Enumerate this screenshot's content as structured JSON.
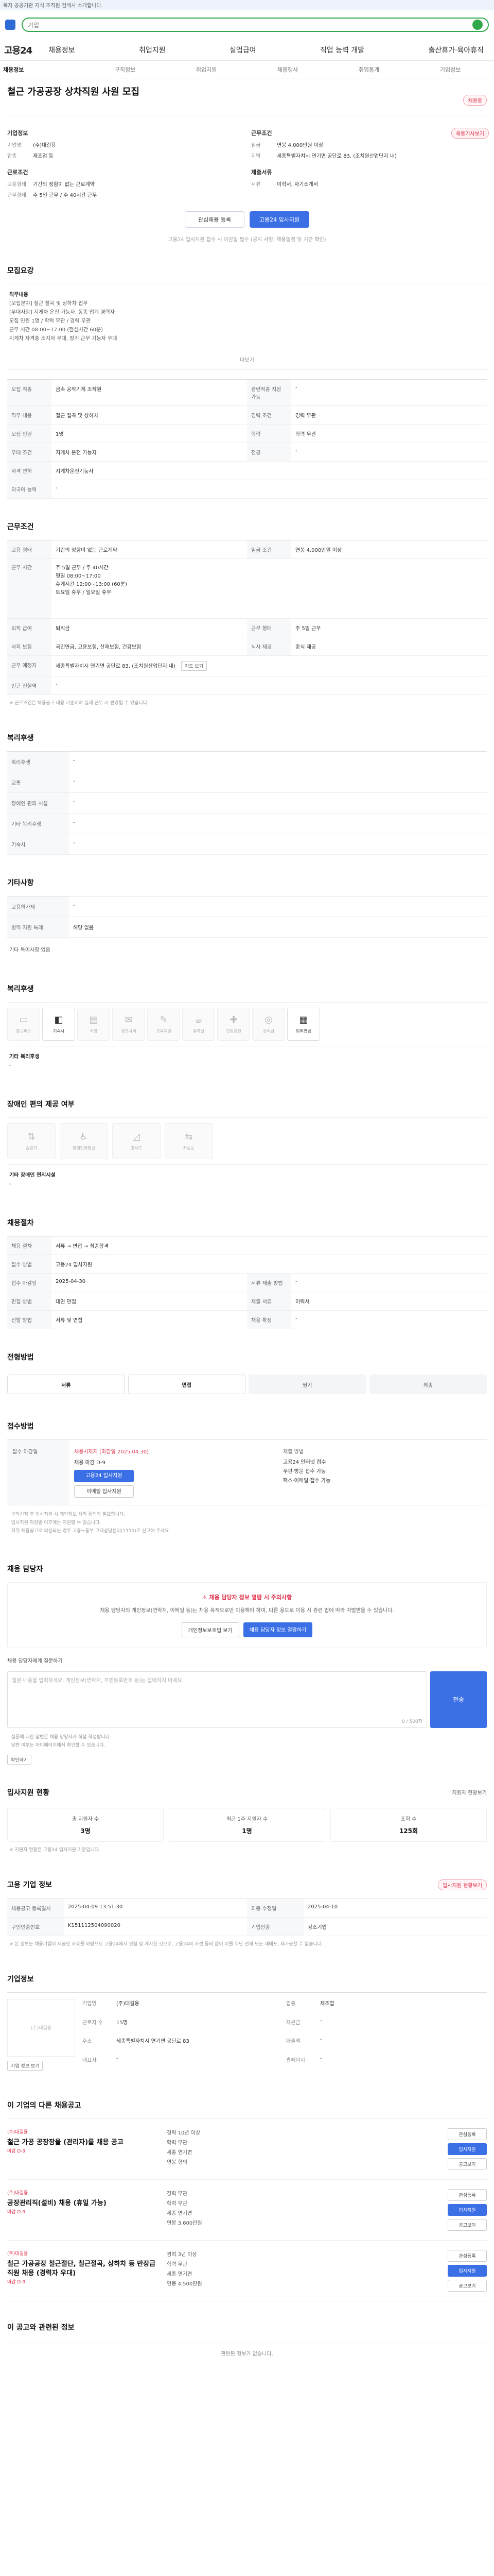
{
  "topbar": {
    "notice": "복지 공공기관 지식 조직원 검색사 소개합니다."
  },
  "header": {
    "search_placeholder": "기업"
  },
  "gnb": {
    "logo": "고용24",
    "menu": [
      "채용정보",
      "취업지원",
      "실업급여",
      "직업 능력 개발",
      "출산휴가·육아휴직"
    ]
  },
  "tabs": [
    "채용정보",
    "구직정보",
    "취업지원",
    "채용행사",
    "취업통계",
    "기업정보"
  ],
  "badge": "채용기사보기",
  "job": {
    "title": "철근 가공공장 상차직원 사원 모집",
    "tag": "채용중",
    "left_heading_company": "기업정보",
    "company": [
      {
        "k": "기업명",
        "v": "(주)대길용"
      },
      {
        "k": "업종",
        "v": "제조업 등"
      }
    ],
    "left_heading_conditions": "근로조건",
    "conditions": [
      {
        "k": "고용형태",
        "v": "기간의 정함이 없는 근로계약"
      },
      {
        "k": "근무형태",
        "v": "주 5일 근무 / 주 40시간 근무"
      }
    ],
    "right_heading": "근무조건",
    "right": [
      {
        "k": "임금",
        "v": "연봉 4,000만원 이상"
      },
      {
        "k": "지역",
        "v": "세종특별자치시 연기면 공단로 83, (조치원산업단지 내)"
      }
    ],
    "right_heading2": "제출서류",
    "right2": [
      {
        "k": "서류",
        "v": "이력서, 자기소개서"
      }
    ],
    "btn_save": "관심채용 등록",
    "btn_apply": "고용24 입사지원",
    "apply_note": "고용24 입사지원 접수 시 마감일 필수 (공지 사항, 채용일정 및 기간 확인)"
  },
  "recruit": {
    "heading": "모집요강",
    "title_label": "직무내용",
    "body": [
      "[모집분야] 철근 절곡 및 상하차 업무",
      "[우대사항] 지게차 운전 가능자, 동종 업계 경력자",
      "모집 인원 1명 / 학력 무관 / 경력 무관",
      "근무 시간 08:00~17:00 (점심시간 60분)",
      "지게차 자격증 소지자 우대, 장기 근무 가능자 우대"
    ],
    "more": "더보기",
    "rows": [
      {
        "k": "모집 직종",
        "v": "금속 공작기계 조작원",
        "k2": "관련직종 지원 가능",
        "v2": "-"
      },
      {
        "k": "직무 내용",
        "v": "철근 절곡 및 상하차",
        "k2": "경력 조건",
        "v2": "경력 무관"
      },
      {
        "k": "모집 인원",
        "v": "1명",
        "k2": "학력",
        "v2": "학력 무관"
      },
      {
        "k": "우대 조건",
        "v": "지게차 운전 가능자",
        "k2": "전공",
        "v2": "-"
      },
      {
        "k": "자격 면허",
        "v": "지게차운전기능사",
        "k2": "",
        "v2": ""
      },
      {
        "k": "외국어 능력",
        "v": "-",
        "k2": "",
        "v2": ""
      }
    ]
  },
  "work": {
    "heading": "근무조건",
    "rows1": [
      {
        "k": "고용 형태",
        "v": "기간의 정함이 없는 근로계약",
        "k2": "임금 조건",
        "v2": "연봉 4,000만원 이상"
      }
    ],
    "hours_label": "근무 시간",
    "hours": [
      "주 5일 근무 / 주 40시간",
      "평일 08:00~17:00",
      "휴게시간 12:00~13:00 (60분)",
      "토요일 휴무 / 일요일 휴무"
    ],
    "rows2": [
      {
        "k": "퇴직 급여",
        "v": "퇴직금",
        "k2": "근무 형태",
        "v2": "주 5일 근무"
      },
      {
        "k": "사회 보험",
        "v": "국민연금, 고용보험, 산재보험, 건강보험",
        "k2": "식사 제공",
        "v2": "중식 제공"
      }
    ],
    "location_label": "근무 예정지",
    "location": "세종특별자치시 연기면 공단로 83, (조치원산업단지 내)",
    "map_btn": "지도 보기",
    "nearby_label": "인근 전철역",
    "nearby": "-",
    "note": "※ 근로조건은 채용공고 내용 기준이며 실제 근무 시 변경될 수 있습니다."
  },
  "benefit": {
    "heading": "복리후생",
    "rows": [
      {
        "k": "복리후생",
        "v": "-"
      },
      {
        "k": "교통",
        "v": "-"
      },
      {
        "k": "장애인 편의 시설",
        "v": "-"
      },
      {
        "k": "기타 복리후생",
        "v": "-"
      },
      {
        "k": "기숙사",
        "v": "-"
      }
    ]
  },
  "etc": {
    "heading": "기타사항",
    "rows": [
      {
        "k": "고용허가제",
        "v": "-"
      },
      {
        "k": "병역 지원 특례",
        "v": "해당 없음"
      }
    ],
    "more": "기타 특이사항 없음"
  },
  "facility": {
    "heading": "복리후생",
    "tiles": [
      "통근버스",
      "기숙사",
      "식당",
      "경조사비",
      "교육지원",
      "휴게실",
      "건강검진",
      "상여금",
      "퇴직연금"
    ],
    "extra_label": "기타 복리후생",
    "extra": "-"
  },
  "disabled": {
    "heading": "장애인 편의 제공 여부",
    "tiles": [
      "승강기",
      "장애인화장실",
      "경사로",
      "자동문"
    ],
    "extra_label": "기타 장애인 편의시설",
    "extra": "-"
  },
  "process": {
    "heading": "채용절차",
    "rows": [
      {
        "k": "채용 절차",
        "v": "서류 → 면접 → 최종합격",
        "k2": "",
        "v2": ""
      },
      {
        "k": "접수 방법",
        "v": "고용24 입사지원",
        "k2": "",
        "v2": ""
      },
      {
        "k": "접수 마감일",
        "v": "2025-04-30",
        "k2": "서류 제출 방법",
        "v2": "-"
      },
      {
        "k": "면접 방법",
        "v": "대면 면접",
        "k2": "제출 서류",
        "v2": "이력서"
      },
      {
        "k": "선발 방법",
        "v": "서류 및 면접",
        "k2": "채용 확정",
        "v2": "-"
      }
    ]
  },
  "status": {
    "heading": "전형방법",
    "steps": [
      "서류",
      "면접",
      "필기",
      "최종"
    ],
    "active": [
      0,
      1
    ]
  },
  "apply_method": {
    "heading": "접수방법",
    "label": "접수 마감일",
    "deadline_title": "채용시까지 (마감일 2025.04.30)",
    "deadline_value": "채용 마감 D-9",
    "btn_apply": "고용24 입사지원",
    "btn_email": "이메일 입사지원",
    "col3_title": "제출 방법",
    "col3_lines": [
      "고용24 인터넷 접수",
      "우편·방문 접수 가능",
      "팩스·이메일 접수 가능"
    ],
    "notes": [
      "· 구직신청 후 입사지원 시 개인정보 처리 동의가 필요합니다.",
      "· 입사지원 마감일 이후에는 지원할 수 없습니다.",
      "· 허위 채용공고로 의심되는 경우 고용노동부 고객상담센터(1350)로 신고해 주세요."
    ]
  },
  "contact": {
    "heading": "채용 담당자",
    "alert": "채용 담당자 정보 열람 시 주의사항",
    "body": "채용 담당자의 개인정보(연락처, 이메일 등)는 채용 목적으로만 이용해야 하며, 다른 용도로 이용 시 관련 법에 따라 처벌받을 수 있습니다.",
    "btn1": "개인정보보호법 보기",
    "btn2": "채용 담당자 정보 열람하기",
    "q_label": "채용 담당자에게 질문하기",
    "q_placeholder": "질문 내용을 입력하세요. 개인정보(연락처, 주민등록번호 등)는 입력하지 마세요.",
    "q_count": "0 / 500자",
    "q_send": "전송",
    "q_notes": [
      "· 질문에 대한 답변은 채용 담당자가 직접 작성합니다.",
      "· 답변 여부는 마이페이지에서 확인할 수 있습니다."
    ],
    "q_btn": "확인하기"
  },
  "stats": {
    "heading": "입사지원 현황",
    "more": "지원자 현황보기",
    "items": [
      {
        "label": "총 지원자 수",
        "value": "3명"
      },
      {
        "label": "최근 1주 지원자 수",
        "value": "1명"
      },
      {
        "label": "조회 수",
        "value": "125회"
      }
    ],
    "note": "※ 지원자 현황은 고용24 입사지원 기준입니다."
  },
  "info": {
    "heading": "고용 기업 정보",
    "btn": "입사지원 현황보기",
    "rows": [
      {
        "k": "채용공고 등록일시",
        "v": "2025-04-09 13:51:30",
        "k2": "최종 수정일",
        "v2": "2025-04-10"
      },
      {
        "k": "구인인증번호",
        "v": "K151112504090020",
        "k2": "기업인증",
        "v2": "강소기업"
      }
    ],
    "note": "※ 본 정보는 채용기업이 제공한 자료를 바탕으로 고용24에서 편집 및 게시한 것으로, 고용24의 사전 동의 없이 이를 무단 전재 또는 재배포, 재가공할 수 없습니다."
  },
  "company": {
    "heading": "기업정보",
    "logo_text": "(주)대길용",
    "btn": "기업 정보 보기",
    "fields": [
      {
        "k": "기업명",
        "v": "(주)대길용"
      },
      {
        "k": "업종",
        "v": "제조업"
      },
      {
        "k": "근로자 수",
        "v": "15명"
      },
      {
        "k": "자본금",
        "v": "-"
      },
      {
        "k": "주소",
        "v": "세종특별자치시 연기면 공단로 83"
      },
      {
        "k": "매출액",
        "v": "-"
      },
      {
        "k": "대표자",
        "v": "-"
      },
      {
        "k": "홈페이지",
        "v": "-"
      }
    ]
  },
  "similar": {
    "heading": "이 기업의 다른 채용공고",
    "jobs": [
      {
        "co": "(주)대길용",
        "title": "철근 가공 공장장을 (관리자)를 채용 공고",
        "meta": [
          "경력 10년 이상",
          "학력 무관",
          "세종 연기면",
          "연봉 협의"
        ],
        "badge": "마감 D-9"
      },
      {
        "co": "(주)대길용",
        "title": "공장관리직(설비) 채용 (휴일 가능)",
        "meta": [
          "경력 무관",
          "학력 무관",
          "세종 연기면",
          "연봉 3,600만원"
        ],
        "badge": "마감 D-9"
      },
      {
        "co": "(주)대길용",
        "title": "철근 가공공장 철근절단, 철근절곡, 상하차 등 반장급 직원 채용 (경력자 우대)",
        "meta": [
          "경력 3년 이상",
          "학력 무관",
          "세종 연기면",
          "연봉 4,500만원"
        ],
        "badge": "마감 D-9"
      }
    ],
    "btns": [
      "관심등록",
      "입사지원",
      "공고보기"
    ]
  },
  "footer": {
    "heading": "이 공고와 관련된 정보",
    "text": "관련된 정보가 없습니다."
  }
}
